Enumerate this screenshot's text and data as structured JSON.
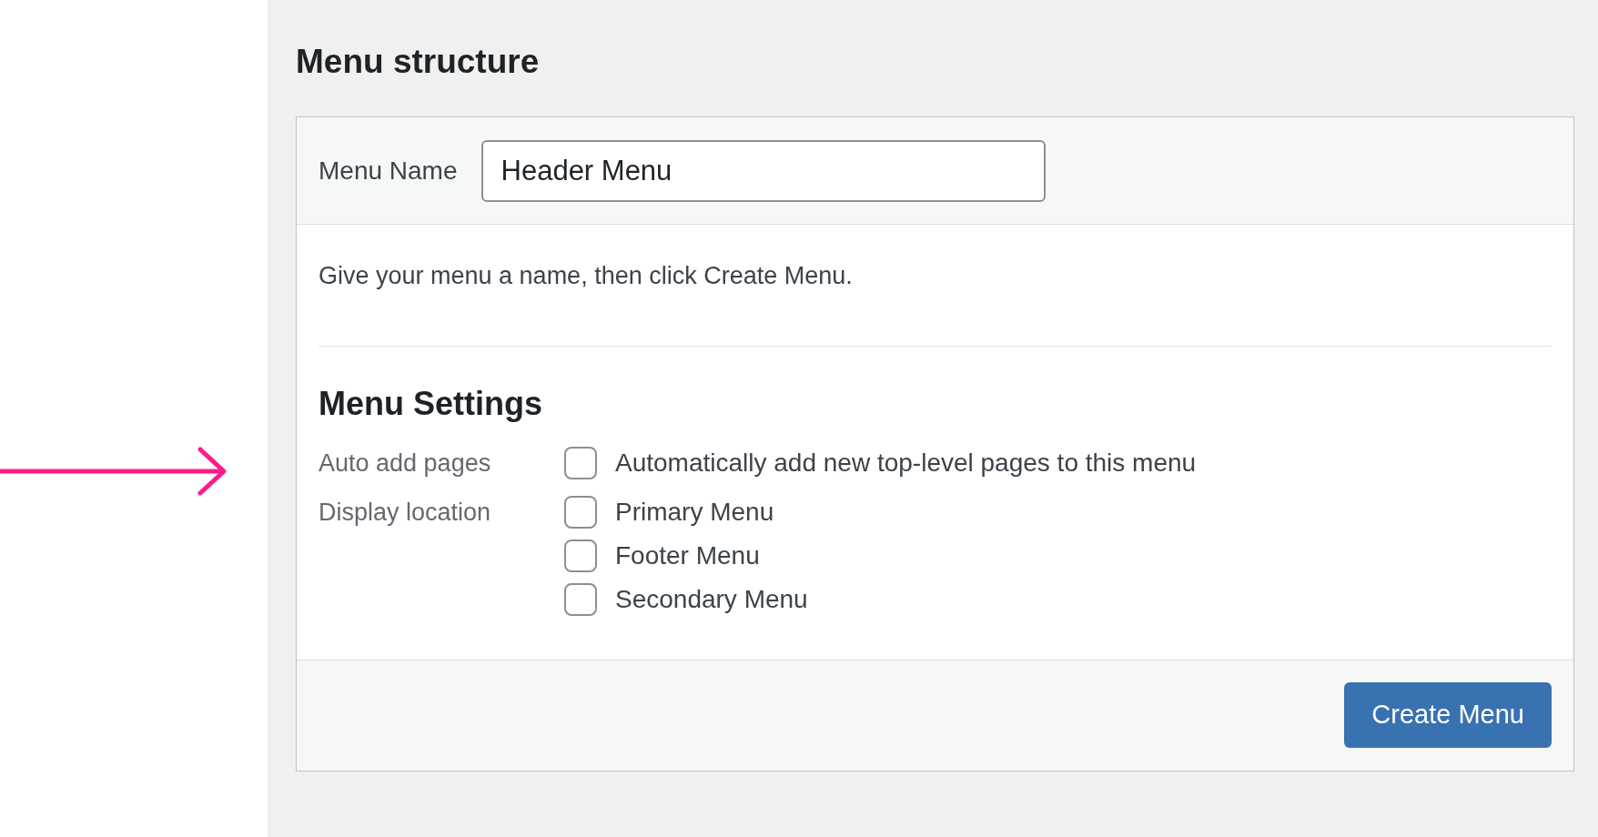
{
  "heading": "Menu structure",
  "menu_name": {
    "label": "Menu Name",
    "value": "Header Menu"
  },
  "description": "Give your menu a name, then click Create Menu.",
  "settings": {
    "title": "Menu Settings",
    "groups": [
      {
        "label": "Auto add pages",
        "options": [
          {
            "label": "Automatically add new top-level pages to this menu",
            "checked": false
          }
        ]
      },
      {
        "label": "Display location",
        "options": [
          {
            "label": "Primary Menu",
            "checked": false
          },
          {
            "label": "Footer Menu",
            "checked": false
          },
          {
            "label": "Secondary Menu",
            "checked": false
          }
        ]
      }
    ]
  },
  "button": "Create Menu"
}
